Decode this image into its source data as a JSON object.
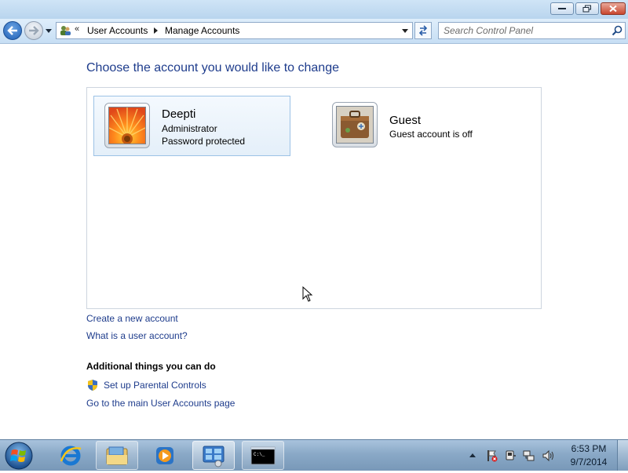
{
  "window": {
    "minimize_label": "Minimize",
    "maximize_label": "Restore",
    "close_label": "Close"
  },
  "address": {
    "overflow": "«",
    "crumbs": [
      "User Accounts",
      "Manage Accounts"
    ]
  },
  "search": {
    "placeholder": "Search Control Panel"
  },
  "main": {
    "title": "Choose the account you would like to change",
    "accounts": [
      {
        "name": "Deepti",
        "lines": [
          "Administrator",
          "Password protected"
        ],
        "selected": true
      },
      {
        "name": "Guest",
        "lines": [
          "Guest account is off"
        ],
        "selected": false
      }
    ],
    "links": {
      "create": "Create a new account",
      "what_is": "What is a user account?"
    },
    "additional": {
      "heading": "Additional things you can do",
      "parental": "Set up Parental Controls",
      "main_page": "Go to the main User Accounts page"
    }
  },
  "taskbar": {
    "clock_time": "6:53 PM",
    "clock_date": "9/7/2014",
    "items": [
      "start-orb",
      "internet-explorer-icon",
      "windows-explorer-icon",
      "media-player-icon",
      "control-panel-icon",
      "command-prompt-icon"
    ]
  },
  "colors": {
    "link": "#1e3c8c",
    "title": "#1e3c8c",
    "selected_bg": "#e4eff9",
    "selected_border": "#9cc2e6"
  }
}
